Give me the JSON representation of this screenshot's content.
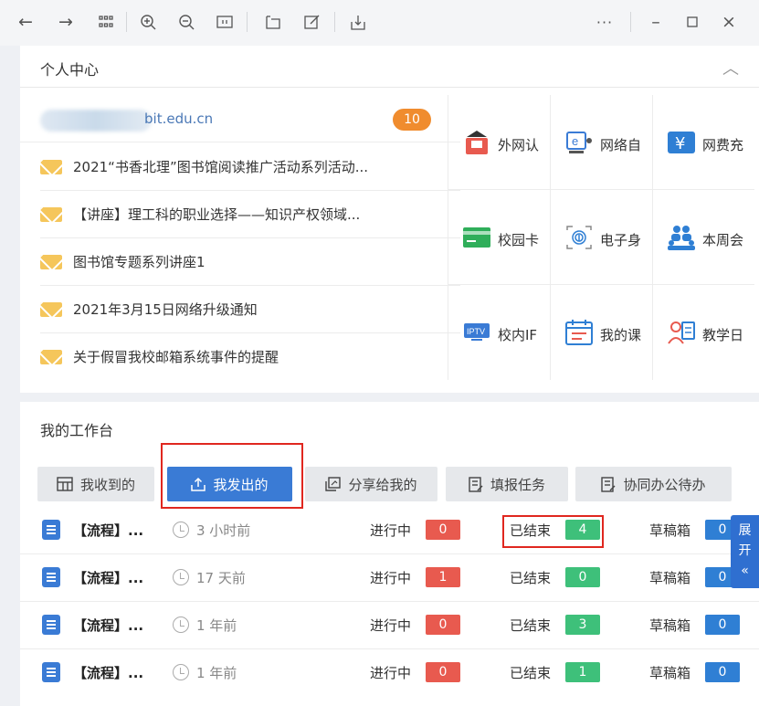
{
  "toolbar": {
    "icons": [
      "back-icon",
      "forward-icon",
      "grid-icon",
      "zoom-in-icon",
      "zoom-out-icon",
      "fit-page-icon",
      "rotate-icon",
      "edit-icon",
      "download-icon",
      "more-icon",
      "minimize-icon",
      "maximize-icon",
      "close-icon"
    ]
  },
  "personal": {
    "title": "个人中心",
    "account_suffix": "bit.edu.cn",
    "unread_count": "10",
    "mails": [
      "2021“书香北理”图书馆阅读推广活动系列活动...",
      "【讲座】理工科的职业选择——知识产权领域...",
      "图书馆专题系列讲座1",
      "2021年3月15日网络升级通知",
      "关于假冒我校邮箱系统事件的提醒"
    ],
    "apps": [
      {
        "label": "外网认",
        "icon": "vpn-auth-icon"
      },
      {
        "label": "网络自",
        "icon": "network-self-service-icon"
      },
      {
        "label": "网费充",
        "icon": "yuan-recharge-icon"
      },
      {
        "label": "校园卡",
        "icon": "campus-card-icon"
      },
      {
        "label": "电子身",
        "icon": "fingerprint-id-icon"
      },
      {
        "label": "本周会",
        "icon": "meeting-people-icon"
      },
      {
        "label": "校内IF",
        "icon": "iptv-icon"
      },
      {
        "label": "我的课",
        "icon": "calendar-schedule-icon"
      },
      {
        "label": "教学日",
        "icon": "teaching-calendar-icon"
      }
    ]
  },
  "workbench": {
    "title": "我的工作台",
    "tabs": [
      "我收到的",
      "我发出的",
      "分享给我的",
      "填报任务",
      "协同办公待办"
    ],
    "active_tab": "我发出的",
    "in_progress_label": "进行中",
    "finished_label": "已结束",
    "draft_label": "草稿箱",
    "rows": [
      {
        "title": "【流程】...",
        "time": "3 小时前",
        "in_progress": "0",
        "finished": "4",
        "draft": "0"
      },
      {
        "title": "【流程】...",
        "time": "17 天前",
        "in_progress": "1",
        "finished": "0",
        "draft": "0"
      },
      {
        "title": "【流程】...",
        "time": "1 年前",
        "in_progress": "0",
        "finished": "3",
        "draft": "0"
      },
      {
        "title": "【流程】...",
        "time": "1 年前",
        "in_progress": "0",
        "finished": "1",
        "draft": "0"
      }
    ],
    "expand_label_1": "展",
    "expand_label_2": "开",
    "expand_arrow": "«"
  },
  "colors": {
    "primary": "#3a7bd5",
    "badge_orange": "#f08c2e",
    "status_red": "#e85a4f",
    "status_green": "#3ec07a",
    "status_blue": "#2f7fd4",
    "highlight_red": "#e0271f"
  }
}
